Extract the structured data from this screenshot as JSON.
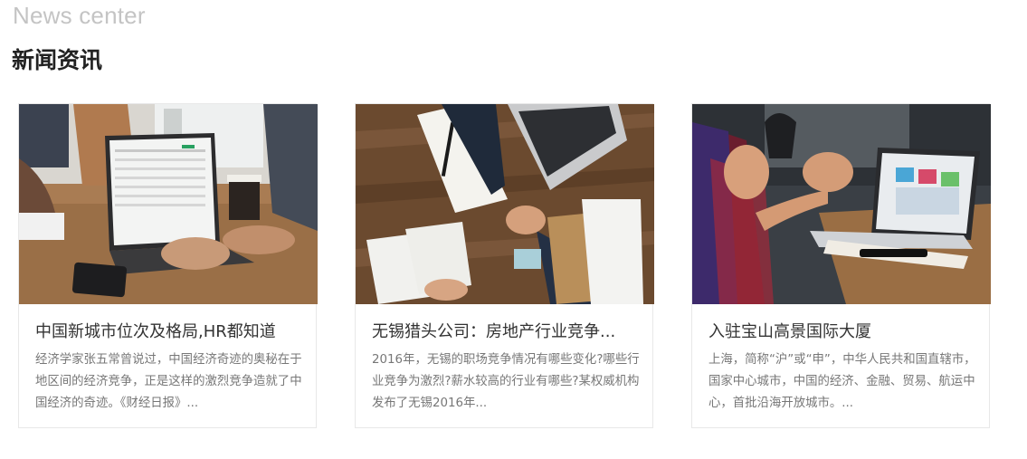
{
  "section": {
    "english_title": "News center",
    "chinese_title": "新闻资讯"
  },
  "cards": [
    {
      "title": "中国新城市位次及格局,HR都知道",
      "description": "经济学家张五常曾说过，中国经济奇迹的奥秘在于地区间的经济竞争，正是这样的激烈竞争造就了中国经济的奇迹。《财经日报》..."
    },
    {
      "title": "无锡猎头公司：房地产行业竞争...",
      "description": "2016年，无锡的职场竞争情况有哪些变化?哪些行业竞争为激烈?薪水较高的行业有哪些?某权威机构发布了无锡2016年..."
    },
    {
      "title": "入驻宝山高景国际大厦",
      "description": "上海，简称“沪”或“申”，中华人民共和国直辖市，国家中心城市，中国的经济、金融、贸易、航运中心，首批沿海开放城市。..."
    }
  ]
}
